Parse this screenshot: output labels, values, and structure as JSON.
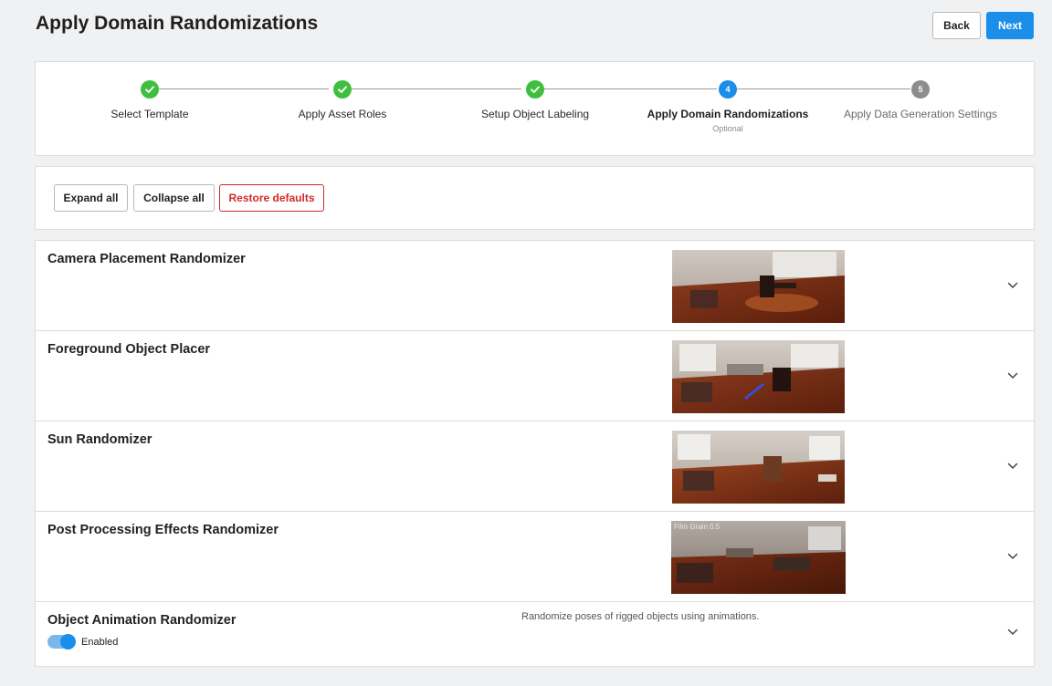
{
  "header": {
    "title": "Apply Domain Randomizations",
    "back_label": "Back",
    "next_label": "Next"
  },
  "stepper": {
    "steps": [
      {
        "number": "1",
        "label": "Select Template",
        "state": "done"
      },
      {
        "number": "2",
        "label": "Apply Asset Roles",
        "state": "done"
      },
      {
        "number": "3",
        "label": "Setup Object Labeling",
        "state": "done"
      },
      {
        "number": "4",
        "label": "Apply Domain Randomizations",
        "state": "active",
        "sublabel": "Optional"
      },
      {
        "number": "5",
        "label": "Apply Data Generation Settings",
        "state": "pending"
      }
    ]
  },
  "toolbar": {
    "expand_label": "Expand all",
    "collapse_label": "Collapse all",
    "restore_label": "Restore defaults"
  },
  "randomizers": [
    {
      "title": "Camera Placement Randomizer",
      "thumbnail": "room-render"
    },
    {
      "title": "Foreground Object Placer",
      "thumbnail": "room-render"
    },
    {
      "title": "Sun Randomizer",
      "thumbnail": "room-render"
    },
    {
      "title": "Post Processing Effects Randomizer",
      "thumbnail": "room-render",
      "overlay": "Film Grain 0.5"
    },
    {
      "title": "Object Animation Randomizer",
      "description": "Randomize poses of rigged objects using animations.",
      "toggle_label": "Enabled",
      "enabled": true
    }
  ],
  "colors": {
    "primary": "#1a8ee8",
    "success": "#3fbf3f",
    "danger": "#d12a2a",
    "pending": "#8d8d8d"
  },
  "icons": {
    "check": "check-icon",
    "chevron": "chevron-down-icon"
  }
}
